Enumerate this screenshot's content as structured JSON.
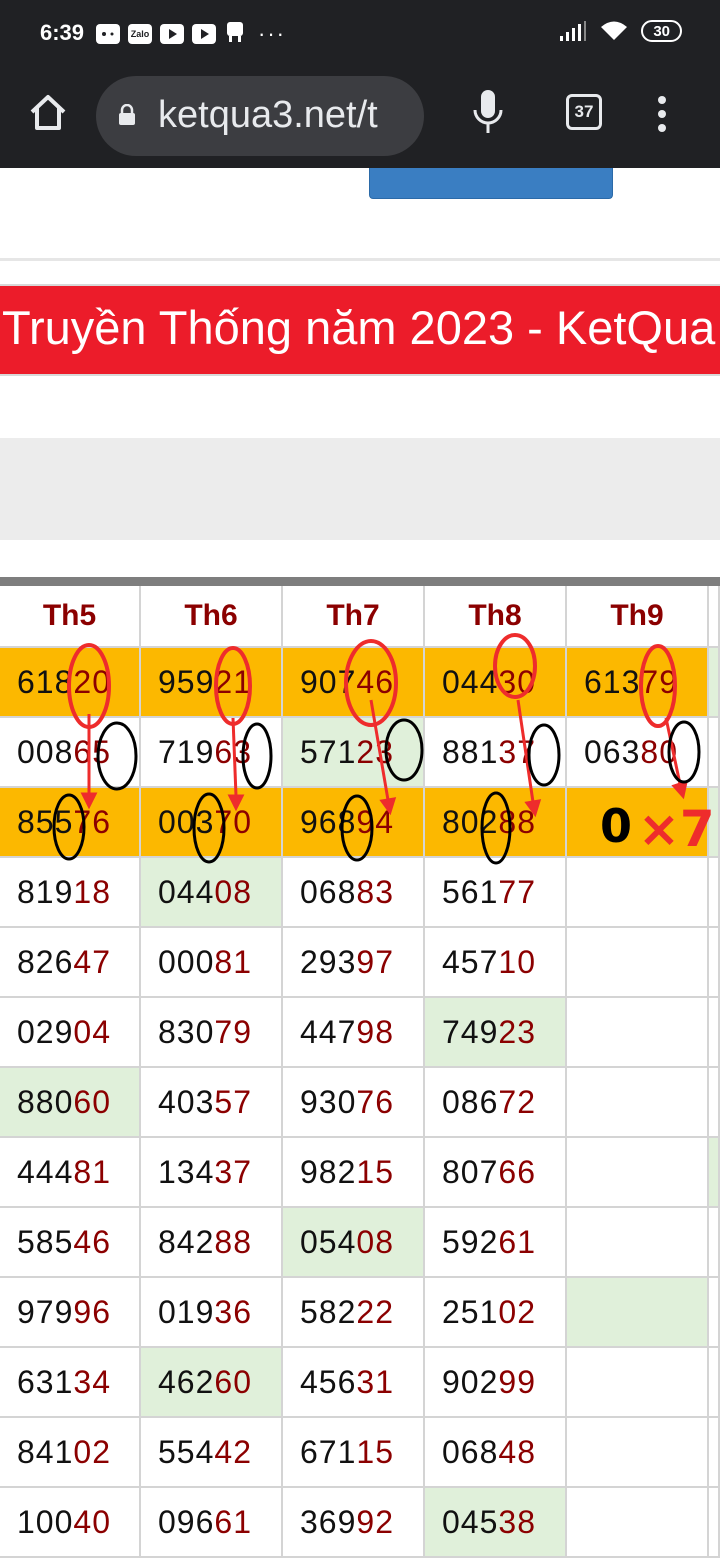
{
  "status_bar": {
    "time": "6:39",
    "apps": [
      "game-icon",
      "Zalo",
      "youtube-icon",
      "youtube-icon",
      "notification-icon"
    ],
    "more": "···",
    "battery": "30"
  },
  "browser": {
    "url": "ketqua3.net/t",
    "tab_count": "37"
  },
  "page": {
    "banner_title": "Truyền Thống năm 2023 - KetQua"
  },
  "table": {
    "headers": [
      "Th5",
      "Th6",
      "Th7",
      "Th8",
      "Th9"
    ],
    "rows": [
      {
        "cells": [
          [
            "618",
            "20",
            "hl"
          ],
          [
            "959",
            "21",
            "hl"
          ],
          [
            "907",
            "46",
            "hl"
          ],
          [
            "044",
            "30",
            "hl"
          ],
          [
            "613",
            "79",
            "hl"
          ]
        ]
      },
      {
        "cells": [
          [
            "008",
            "65",
            ""
          ],
          [
            "719",
            "63",
            ""
          ],
          [
            "571",
            "23",
            "gr"
          ],
          [
            "881",
            "37",
            ""
          ],
          [
            "063",
            "80",
            ""
          ]
        ]
      },
      {
        "cells": [
          [
            "855",
            "76",
            "hl"
          ],
          [
            "003",
            "70",
            "hl"
          ],
          [
            "968",
            "94",
            "hl"
          ],
          [
            "802",
            "88",
            "hl"
          ],
          [
            "",
            "",
            "hl"
          ]
        ]
      },
      {
        "cells": [
          [
            "819",
            "18",
            ""
          ],
          [
            "044",
            "08",
            "gr"
          ],
          [
            "068",
            "83",
            ""
          ],
          [
            "561",
            "77",
            ""
          ],
          [
            "",
            "",
            ""
          ]
        ]
      },
      {
        "cells": [
          [
            "826",
            "47",
            ""
          ],
          [
            "000",
            "81",
            ""
          ],
          [
            "293",
            "97",
            ""
          ],
          [
            "457",
            "10",
            ""
          ],
          [
            "",
            "",
            ""
          ]
        ]
      },
      {
        "cells": [
          [
            "029",
            "04",
            ""
          ],
          [
            "830",
            "79",
            ""
          ],
          [
            "447",
            "98",
            ""
          ],
          [
            "749",
            "23",
            "gr"
          ],
          [
            "",
            "",
            ""
          ]
        ]
      },
      {
        "cells": [
          [
            "880",
            "60",
            "gr"
          ],
          [
            "403",
            "57",
            ""
          ],
          [
            "930",
            "76",
            ""
          ],
          [
            "086",
            "72",
            ""
          ],
          [
            "",
            "",
            ""
          ]
        ]
      },
      {
        "cells": [
          [
            "444",
            "81",
            ""
          ],
          [
            "134",
            "37",
            ""
          ],
          [
            "982",
            "15",
            ""
          ],
          [
            "807",
            "66",
            ""
          ],
          [
            "",
            "",
            ""
          ]
        ]
      },
      {
        "cells": [
          [
            "585",
            "46",
            ""
          ],
          [
            "842",
            "88",
            ""
          ],
          [
            "054",
            "08",
            "gr"
          ],
          [
            "592",
            "61",
            ""
          ],
          [
            "",
            "",
            ""
          ]
        ]
      },
      {
        "cells": [
          [
            "979",
            "96",
            ""
          ],
          [
            "019",
            "36",
            ""
          ],
          [
            "582",
            "22",
            ""
          ],
          [
            "251",
            "02",
            ""
          ],
          [
            "",
            "",
            "gr"
          ]
        ]
      },
      {
        "cells": [
          [
            "631",
            "34",
            ""
          ],
          [
            "462",
            "60",
            "gr"
          ],
          [
            "456",
            "31",
            ""
          ],
          [
            "902",
            "99",
            ""
          ],
          [
            "",
            "",
            ""
          ]
        ]
      },
      {
        "cells": [
          [
            "841",
            "02",
            ""
          ],
          [
            "554",
            "42",
            ""
          ],
          [
            "671",
            "15",
            ""
          ],
          [
            "068",
            "48",
            ""
          ],
          [
            "",
            "",
            ""
          ]
        ]
      },
      {
        "cells": [
          [
            "100",
            "40",
            ""
          ],
          [
            "096",
            "61",
            ""
          ],
          [
            "369",
            "92",
            ""
          ],
          [
            "045",
            "38",
            "gr"
          ],
          [
            "",
            "",
            ""
          ]
        ]
      }
    ]
  },
  "annotation": {
    "handwritten": "0×7",
    "zero": "0",
    "times_seven": "×7",
    "marker_red": "#ee2c2c",
    "marker_black": "#000000"
  }
}
